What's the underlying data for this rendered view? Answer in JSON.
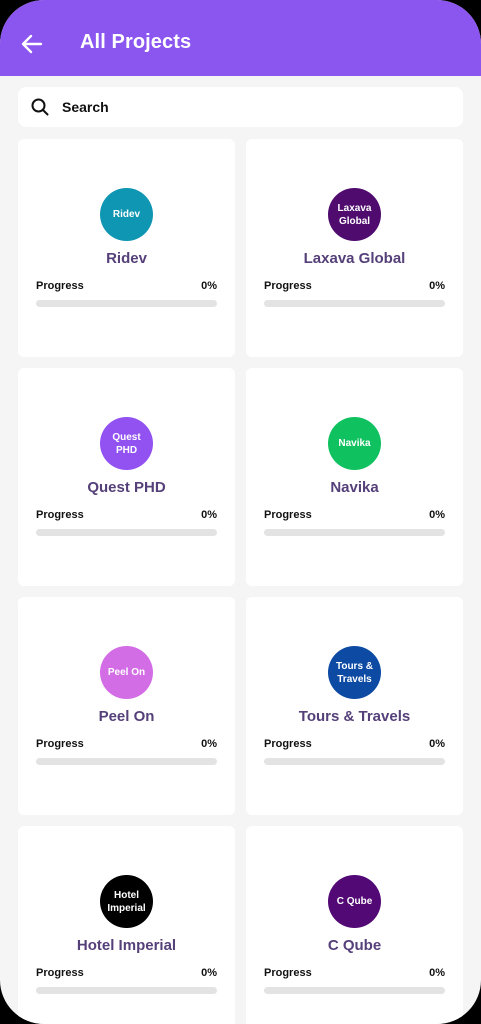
{
  "header": {
    "title": "All Projects"
  },
  "search": {
    "placeholder": "Search"
  },
  "colors": {
    "appbar": "#8b55f0",
    "background": "#f5f5f5",
    "project_name": "#55407a"
  },
  "progress_label": "Progress",
  "projects": [
    {
      "name": "Ridev",
      "avatar_text": "Ridev",
      "avatar_color": "#0f96b2",
      "progress_text": "0%",
      "progress": 0
    },
    {
      "name": "Laxava Global",
      "avatar_text": "Laxava Global",
      "avatar_color": "#4f0b6e",
      "progress_text": "0%",
      "progress": 0
    },
    {
      "name": "Quest PHD",
      "avatar_text": "Quest PHD",
      "avatar_color": "#9252f2",
      "progress_text": "0%",
      "progress": 0
    },
    {
      "name": "Navika",
      "avatar_text": "Navika",
      "avatar_color": "#10c160",
      "progress_text": "0%",
      "progress": 0
    },
    {
      "name": "Peel On",
      "avatar_text": "Peel On",
      "avatar_color": "#d36de6",
      "progress_text": "0%",
      "progress": 0
    },
    {
      "name": "Tours & Travels",
      "avatar_text": "Tours & Travels",
      "avatar_color": "#0c4aa3",
      "progress_text": "0%",
      "progress": 0
    },
    {
      "name": "Hotel Imperial",
      "avatar_text": "Hotel Imperial",
      "avatar_color": "#000000",
      "progress_text": "0%",
      "progress": 0
    },
    {
      "name": "C Qube",
      "avatar_text": "C Qube",
      "avatar_color": "#520975",
      "progress_text": "0%",
      "progress": 0
    }
  ]
}
